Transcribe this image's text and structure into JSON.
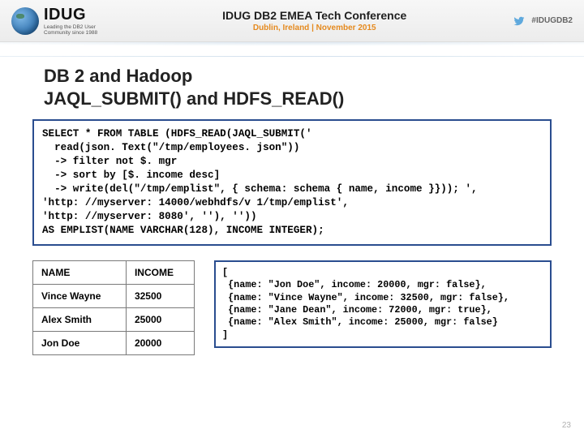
{
  "header": {
    "logo_text": "IDUG",
    "logo_sub": "Leading the DB2 User Community since 1988",
    "conf_title": "IDUG DB2 EMEA Tech Conference",
    "conf_sub": "Dublin, Ireland  |  November 2015",
    "hashtag": "#IDUGDB2"
  },
  "title": {
    "line1": "DB 2 and Hadoop",
    "line2": "JAQL_SUBMIT() and HDFS_READ()"
  },
  "code": "SELECT * FROM TABLE (HDFS_READ(JAQL_SUBMIT('\n  read(json. Text(\"/tmp/employees. json\"))\n  -> filter not $. mgr\n  -> sort by [$. income desc]\n  -> write(del(\"/tmp/emplist\", { schema: schema { name, income }})); ',\n'http: //myserver: 14000/webhdfs/v 1/tmp/emplist',\n'http: //myserver: 8080', ''), ''))\nAS EMPLIST(NAME VARCHAR(128), INCOME INTEGER);",
  "table": {
    "headers": [
      "NAME",
      "INCOME"
    ],
    "rows": [
      [
        "Vince Wayne",
        "32500"
      ],
      [
        "Alex Smith",
        "25000"
      ],
      [
        "Jon Doe",
        "20000"
      ]
    ]
  },
  "json_output": "[\n {name: \"Jon Doe\", income: 20000, mgr: false},\n {name: \"Vince Wayne\", income: 32500, mgr: false},\n {name: \"Jane Dean\", income: 72000, mgr: true},\n {name: \"Alex Smith\", income: 25000, mgr: false}\n]",
  "page_number": "23"
}
